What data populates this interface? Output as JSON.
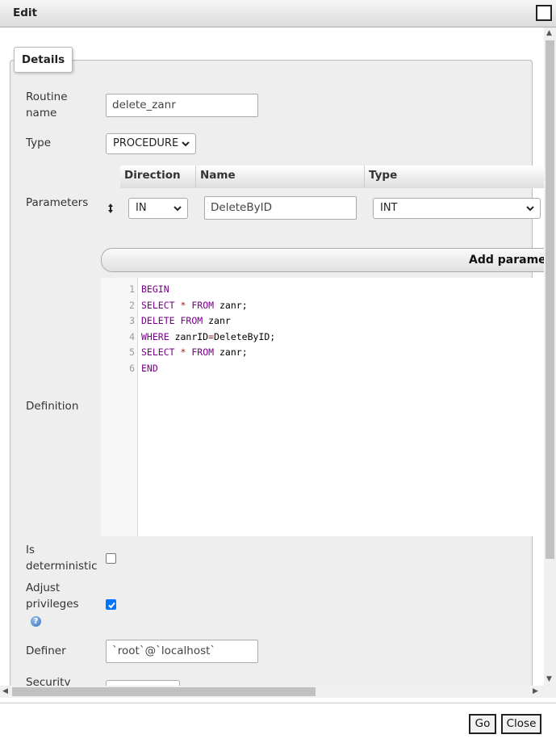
{
  "dialog": {
    "title": "Edit",
    "go_label": "Go",
    "close_label": "Close"
  },
  "tab": {
    "label": "Details"
  },
  "fields": {
    "routine_name_label_1": "Routine",
    "routine_name_label_2": "name",
    "routine_name_value": "delete_zanr",
    "type_label": "Type",
    "type_value": "PROCEDURE",
    "parameters_label": "Parameters",
    "definition_label": "Definition",
    "deterministic_label_1": "Is",
    "deterministic_label_2": "deterministic",
    "deterministic_checked": false,
    "adjust_label_1": "Adjust",
    "adjust_label_2": "privileges",
    "adjust_checked": true,
    "definer_label": "Definer",
    "definer_value": "`root`@`localhost`",
    "security_label": "Security"
  },
  "parameters": {
    "headers": [
      "Direction",
      "Name",
      "Type"
    ],
    "rows": [
      {
        "direction": "IN",
        "name": "DeleteByID",
        "type": "INT"
      }
    ],
    "add_label": "Add parameter"
  },
  "definition": {
    "line_numbers": [
      "1",
      "2",
      "3",
      "4",
      "5",
      "6"
    ],
    "lines": [
      "BEGIN",
      "SELECT * FROM zanr;",
      "DELETE FROM zanr",
      "WHERE zanrID=DeleteByID;",
      "SELECT * FROM zanr;",
      "END"
    ]
  },
  "icons": [
    "reorder-arrows-icon",
    "help-icon",
    "chevron-down-icon",
    "maximize-icon"
  ]
}
